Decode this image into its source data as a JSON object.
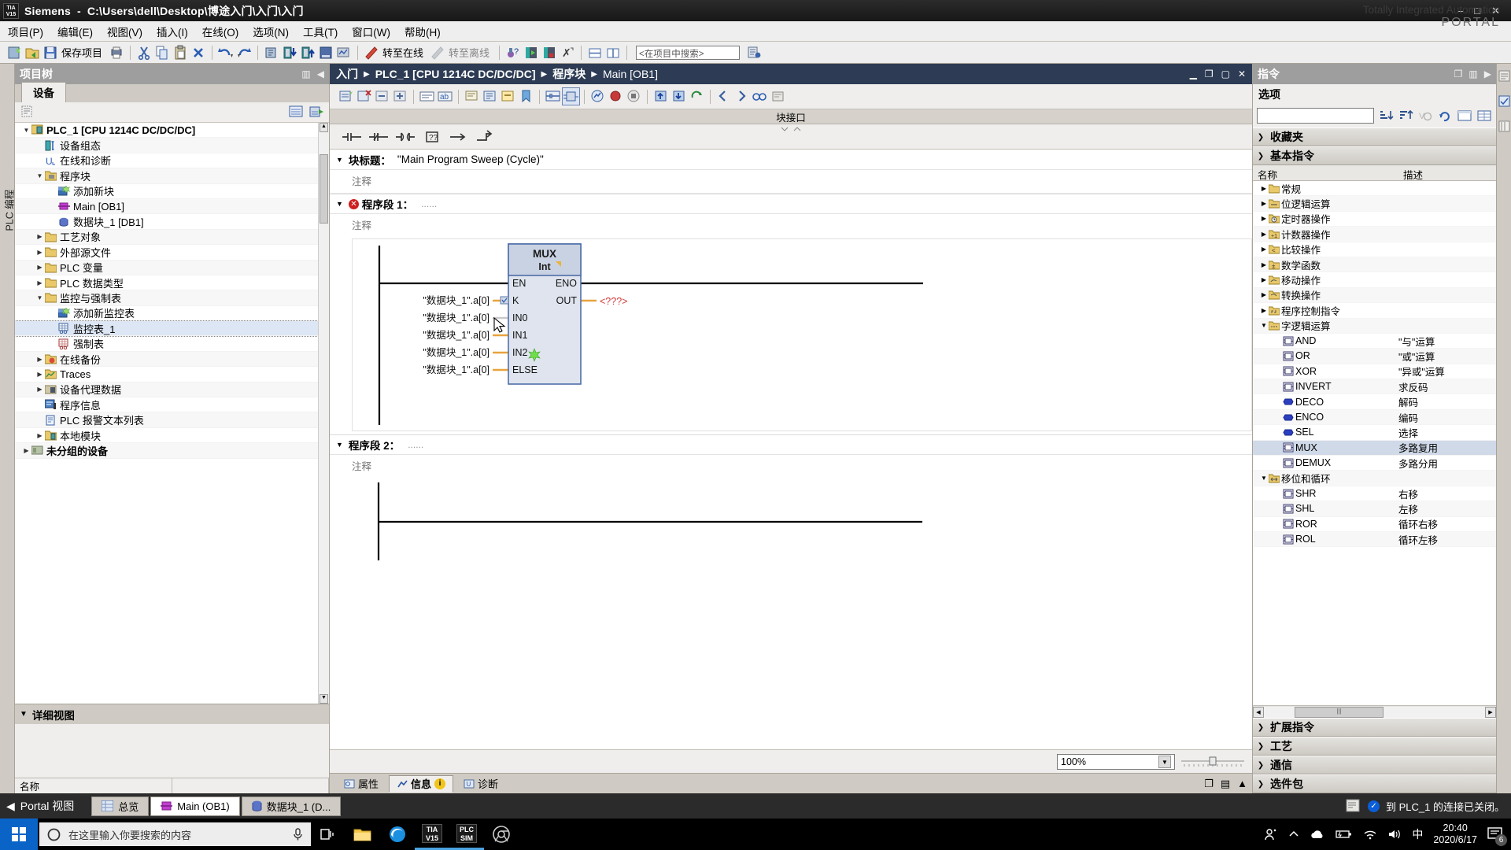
{
  "titlebar": {
    "logo": "TIA V15",
    "app": "Siemens",
    "dash": "-",
    "path": "C:\\Users\\dell\\Desktop\\博途入门\\入门\\入门",
    "minimize": "–",
    "maximize": "□",
    "close": "✕"
  },
  "menu": {
    "items": [
      "项目(P)",
      "编辑(E)",
      "视图(V)",
      "插入(I)",
      "在线(O)",
      "选项(N)",
      "工具(T)",
      "窗口(W)",
      "帮助(H)"
    ],
    "brand_line1": "Totally Integrated Automation",
    "brand_line2": "PORTAL"
  },
  "toolbar": {
    "save_label": "保存项目",
    "goonline_label": "转至在线",
    "gooffline_label": "转至离线",
    "search_placeholder": "<在项目中搜索>",
    "icons": [
      "new-project-icon",
      "open-project-icon",
      "save-icon",
      "print-icon",
      "cut-icon",
      "copy-icon",
      "paste-icon",
      "delete-icon",
      "undo-icon",
      "redo-icon",
      "compile-icon",
      "download-icon",
      "upload-icon",
      "start-sim-icon",
      "stop-sim-icon",
      "go-online-icon",
      "go-offline-icon",
      "diagnostics-icon",
      "start-cpu-icon",
      "stop-cpu-icon",
      "cross-reference-icon",
      "split-horizontal-icon",
      "split-vertical-icon",
      "search-in-project-icon"
    ]
  },
  "leftstrip": {
    "label": "PLC 编程"
  },
  "tree": {
    "title": "项目树",
    "tab": "设备",
    "detail_title": "详细视图",
    "detail_col_name": "名称",
    "items": [
      {
        "label": "PLC_1 [CPU 1214C DC/DC/DC]",
        "indent": 1,
        "arrow": "▼",
        "icon": "plc-device-icon",
        "bold": true
      },
      {
        "label": "设备组态",
        "indent": 2,
        "arrow": "",
        "icon": "device-config-icon"
      },
      {
        "label": "在线和诊断",
        "indent": 2,
        "arrow": "",
        "icon": "online-diagnostics-icon"
      },
      {
        "label": "程序块",
        "indent": 2,
        "arrow": "▼",
        "icon": "program-blocks-folder-icon"
      },
      {
        "label": "添加新块",
        "indent": 3,
        "arrow": "",
        "icon": "add-new-block-icon"
      },
      {
        "label": "Main [OB1]",
        "indent": 3,
        "arrow": "",
        "icon": "ob-block-icon"
      },
      {
        "label": "数据块_1 [DB1]",
        "indent": 3,
        "arrow": "",
        "icon": "db-block-icon"
      },
      {
        "label": "工艺对象",
        "indent": 2,
        "arrow": "▶",
        "icon": "technology-objects-folder-icon"
      },
      {
        "label": "外部源文件",
        "indent": 2,
        "arrow": "▶",
        "icon": "external-source-folder-icon"
      },
      {
        "label": "PLC 变量",
        "indent": 2,
        "arrow": "▶",
        "icon": "plc-tags-folder-icon"
      },
      {
        "label": "PLC 数据类型",
        "indent": 2,
        "arrow": "▶",
        "icon": "plc-data-types-folder-icon"
      },
      {
        "label": "监控与强制表",
        "indent": 2,
        "arrow": "▼",
        "icon": "watch-force-tables-folder-icon"
      },
      {
        "label": "添加新监控表",
        "indent": 3,
        "arrow": "",
        "icon": "add-watch-table-icon"
      },
      {
        "label": "监控表_1",
        "indent": 3,
        "arrow": "",
        "icon": "watch-table-icon",
        "selected": true
      },
      {
        "label": "强制表",
        "indent": 3,
        "arrow": "",
        "icon": "force-table-icon"
      },
      {
        "label": "在线备份",
        "indent": 2,
        "arrow": "▶",
        "icon": "online-backups-folder-icon"
      },
      {
        "label": "Traces",
        "indent": 2,
        "arrow": "▶",
        "icon": "traces-folder-icon"
      },
      {
        "label": "设备代理数据",
        "indent": 2,
        "arrow": "▶",
        "icon": "device-proxy-data-icon"
      },
      {
        "label": "程序信息",
        "indent": 2,
        "arrow": "",
        "icon": "program-info-icon"
      },
      {
        "label": "PLC 报警文本列表",
        "indent": 2,
        "arrow": "",
        "icon": "plc-alarm-text-list-icon"
      },
      {
        "label": "本地模块",
        "indent": 2,
        "arrow": "▶",
        "icon": "local-modules-folder-icon"
      },
      {
        "label": "未分组的设备",
        "indent": 1,
        "arrow": "▶",
        "icon": "ungrouped-devices-icon",
        "bold": true
      }
    ]
  },
  "editor": {
    "breadcrumb": [
      "入门",
      "PLC_1 [CPU 1214C DC/DC/DC]",
      "程序块",
      "Main [OB1]"
    ],
    "block_interface_label": "块接口",
    "block_title_label": "块标题：",
    "block_title_value": "\"Main Program Sweep (Cycle)\"",
    "comment": "注释",
    "networks": [
      {
        "name": "程序段 1：",
        "dots": "......",
        "error": true,
        "comment": "注释"
      },
      {
        "name": "程序段 2：",
        "dots": "......",
        "error": false,
        "comment": "注释"
      }
    ],
    "zoom_value": "100%",
    "bottom_tabs": [
      {
        "label": "属性",
        "icon": "properties-icon",
        "active": false
      },
      {
        "label": "信息",
        "icon": "info-icon",
        "active": true,
        "badge": "i"
      },
      {
        "label": "诊断",
        "icon": "diagnostics-icon",
        "active": false
      }
    ],
    "fav_icons": [
      "no-contact-icon",
      "nc-contact-icon",
      "coil-icon",
      "empty-box-icon",
      "branch-open-icon",
      "branch-close-icon"
    ],
    "mux_block": {
      "name": "MUX",
      "type": "Int",
      "en": "EN",
      "eno": "ENO",
      "out": "OUT",
      "out_value": "<???>",
      "inputs": [
        {
          "pin": "K",
          "operand": "\"数据块_1\".a[0]"
        },
        {
          "pin": "IN0",
          "operand": "\"数据块_1\".a[0]"
        },
        {
          "pin": "IN1",
          "operand": "\"数据块_1\".a[0]"
        },
        {
          "pin": "IN2",
          "operand": "\"数据块_1\".a[0]",
          "star": true
        },
        {
          "pin": "ELSE",
          "operand": "\"数据块_1\".a[0]"
        }
      ]
    }
  },
  "instructions": {
    "title": "指令",
    "options_label": "选项",
    "search_value": "",
    "favorites_label": "收藏夹",
    "basic_label": "基本指令",
    "col_name": "名称",
    "col_desc": "描述",
    "rows": [
      {
        "name": "常规",
        "desc": "",
        "indent": 1,
        "arrow": "▶",
        "icon": "folder-icon"
      },
      {
        "name": "位逻辑运算",
        "desc": "",
        "indent": 1,
        "arrow": "▶",
        "icon": "bit-logic-folder-icon"
      },
      {
        "name": "定时器操作",
        "desc": "",
        "indent": 1,
        "arrow": "▶",
        "icon": "timer-folder-icon"
      },
      {
        "name": "计数器操作",
        "desc": "",
        "indent": 1,
        "arrow": "▶",
        "icon": "counter-folder-icon"
      },
      {
        "name": "比较操作",
        "desc": "",
        "indent": 1,
        "arrow": "▶",
        "icon": "compare-folder-icon"
      },
      {
        "name": "数学函数",
        "desc": "",
        "indent": 1,
        "arrow": "▶",
        "icon": "math-folder-icon"
      },
      {
        "name": "移动操作",
        "desc": "",
        "indent": 1,
        "arrow": "▶",
        "icon": "move-folder-icon"
      },
      {
        "name": "转换操作",
        "desc": "",
        "indent": 1,
        "arrow": "▶",
        "icon": "convert-folder-icon"
      },
      {
        "name": "程序控制指令",
        "desc": "",
        "indent": 1,
        "arrow": "▶",
        "icon": "program-control-folder-icon"
      },
      {
        "name": "字逻辑运算",
        "desc": "",
        "indent": 1,
        "arrow": "▼",
        "icon": "word-logic-folder-icon"
      },
      {
        "name": "AND",
        "desc": "\"与\"运算",
        "indent": 2,
        "arrow": "",
        "icon": "box-instruction-icon"
      },
      {
        "name": "OR",
        "desc": "\"或\"运算",
        "indent": 2,
        "arrow": "",
        "icon": "box-instruction-icon"
      },
      {
        "name": "XOR",
        "desc": "\"异或\"运算",
        "indent": 2,
        "arrow": "",
        "icon": "box-instruction-icon"
      },
      {
        "name": "INVERT",
        "desc": "求反码",
        "indent": 2,
        "arrow": "",
        "icon": "box-instruction-icon"
      },
      {
        "name": "DECO",
        "desc": "解码",
        "indent": 2,
        "arrow": "",
        "icon": "blue-block-icon"
      },
      {
        "name": "ENCO",
        "desc": "编码",
        "indent": 2,
        "arrow": "",
        "icon": "blue-block-icon"
      },
      {
        "name": "SEL",
        "desc": "选择",
        "indent": 2,
        "arrow": "",
        "icon": "blue-block-icon"
      },
      {
        "name": "MUX",
        "desc": "多路复用",
        "indent": 2,
        "arrow": "",
        "icon": "box-instruction-icon",
        "selected": true
      },
      {
        "name": "DEMUX",
        "desc": "多路分用",
        "indent": 2,
        "arrow": "",
        "icon": "box-instruction-icon"
      },
      {
        "name": "移位和循环",
        "desc": "",
        "indent": 1,
        "arrow": "▼",
        "icon": "shift-rotate-folder-icon"
      },
      {
        "name": "SHR",
        "desc": "右移",
        "indent": 2,
        "arrow": "",
        "icon": "box-instruction-icon"
      },
      {
        "name": "SHL",
        "desc": "左移",
        "indent": 2,
        "arrow": "",
        "icon": "box-instruction-icon"
      },
      {
        "name": "ROR",
        "desc": "循环右移",
        "indent": 2,
        "arrow": "",
        "icon": "box-instruction-icon"
      },
      {
        "name": "ROL",
        "desc": "循环左移",
        "indent": 2,
        "arrow": "",
        "icon": "box-instruction-icon"
      }
    ],
    "sections": [
      {
        "label": "扩展指令"
      },
      {
        "label": "工艺"
      },
      {
        "label": "通信"
      },
      {
        "label": "选件包"
      }
    ]
  },
  "portalbar": {
    "portal_view": "Portal 视图",
    "tabs": [
      {
        "label": "总览",
        "icon": "overview-icon",
        "active": false
      },
      {
        "label": "Main (OB1)",
        "icon": "ob-block-icon",
        "active": true
      },
      {
        "label": "数据块_1 (D...",
        "icon": "db-block-icon",
        "active": false
      }
    ],
    "status": "到 PLC_1 的连接已关闭。"
  },
  "taskbar": {
    "search_placeholder": "在这里输入你要搜索的内容",
    "items": [
      "task-view-icon",
      "file-explorer-icon",
      "edge-icon",
      "tia-portal-v15-icon",
      "plcsim-icon",
      "chrome-icon"
    ],
    "tray": [
      "people-icon",
      "show-hidden-icon",
      "onedrive-icon",
      "battery-icon",
      "wifi-icon",
      "volume-icon"
    ],
    "ime": "中",
    "time": "20:40",
    "date": "2020/6/17",
    "notification_count": "6"
  },
  "colors": {
    "accent_blue": "#2d3c54",
    "block_fill": "#d6dce8",
    "block_header": "#c2cada",
    "wire_orange": "#e8a33d",
    "error_red": "#cf2020",
    "selection_blue": "#cfd9e8",
    "taskbar_black": "#000000",
    "start_blue": "#0a64c8"
  }
}
